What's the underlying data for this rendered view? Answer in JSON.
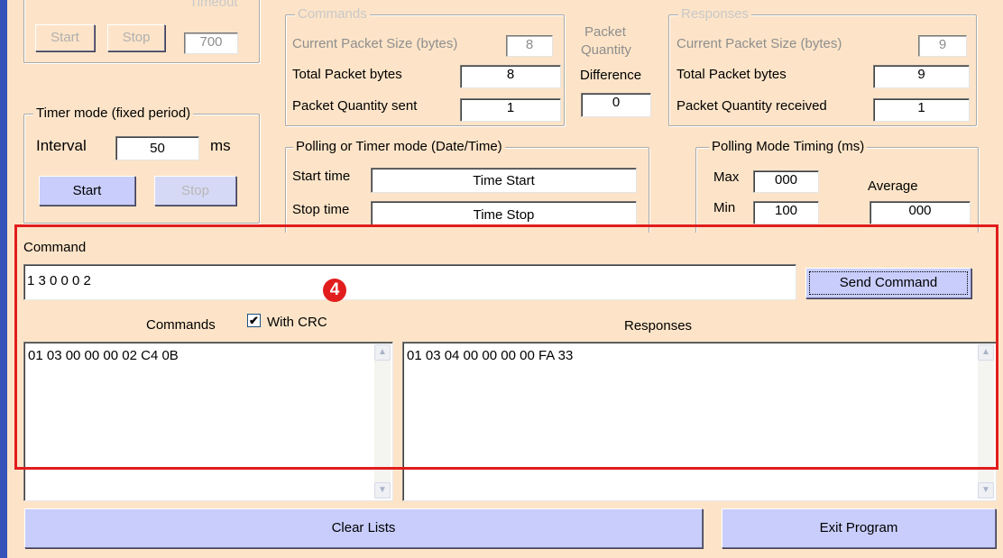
{
  "top_left": {
    "start_label": "Start",
    "stop_label": "Stop",
    "timeout_label": "Timeout",
    "timeout_value": "700"
  },
  "timer_mode": {
    "legend": "Timer mode (fixed period)",
    "interval_label": "Interval",
    "interval_value": "50",
    "unit": "ms",
    "start_label": "Start",
    "stop_label": "Stop"
  },
  "commands_group": {
    "legend": "Commands",
    "current_size_label": "Current Packet Size (bytes)",
    "current_size_value": "8",
    "total_bytes_label": "Total Packet bytes",
    "total_bytes_value": "8",
    "qty_sent_label": "Packet Quantity sent",
    "qty_sent_value": "1"
  },
  "packet_quantity": {
    "label_line1": "Packet",
    "label_line2": "Quantity",
    "difference_label": "Difference",
    "difference_value": "0"
  },
  "responses_group": {
    "legend": "Responses",
    "current_size_label": "Current Packet Size (bytes)",
    "current_size_value": "9",
    "total_bytes_label": "Total Packet bytes",
    "total_bytes_value": "9",
    "qty_received_label": "Packet Quantity received",
    "qty_received_value": "1"
  },
  "polling_timer": {
    "legend": "Polling  or Timer mode  (Date/Time)",
    "start_time_label": "Start time",
    "start_time_value": "Time Start",
    "stop_time_label": "Stop time",
    "stop_time_value": "Time Stop"
  },
  "polling_timing": {
    "legend": "Polling Mode Timing (ms)",
    "max_label": "Max",
    "max_value": "000",
    "min_label": "Min",
    "min_value": "100",
    "average_label": "Average",
    "average_value": "000"
  },
  "command": {
    "label": "Command",
    "input_value": "1 3 0 0 0 2",
    "send_label": "Send Command"
  },
  "lists": {
    "commands_label": "Commands",
    "with_crc_label": "With CRC",
    "with_crc_checked": "✔",
    "responses_label": "Responses",
    "commands_entry": "01 03 00 00 00 02 C4 0B",
    "responses_entry": "01 03 04 00 00 00 00 FA 33"
  },
  "bottom": {
    "clear_label": "Clear Lists",
    "exit_label": "Exit Program"
  },
  "annotation": {
    "badge": "4"
  },
  "colors": {
    "background": "#fde4c8",
    "button": "#c8cdfb",
    "highlight_box": "#e11d1d",
    "left_bar": "#3553b8"
  }
}
